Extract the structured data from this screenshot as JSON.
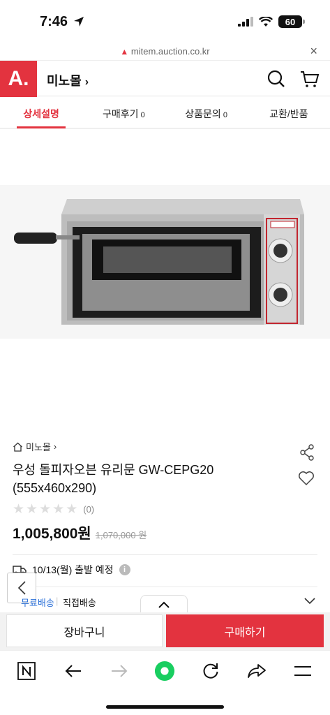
{
  "status": {
    "time": "7:46",
    "battery": "60"
  },
  "browser": {
    "url": "mitem.auction.co.kr"
  },
  "header": {
    "logo": "A.",
    "mall_name": "미노몰"
  },
  "tabs": [
    {
      "label": "상세설명",
      "count": ""
    },
    {
      "label": "구매후기",
      "count": "0"
    },
    {
      "label": "상품문의",
      "count": "0"
    },
    {
      "label": "교환/반품",
      "count": ""
    }
  ],
  "product": {
    "breadcrumb": "미노몰",
    "title": "우성 돌피자오븐 유리문 GW-CEPG20 (555x460x290)",
    "review_count": "(0)",
    "rating": 0,
    "price": "1,005,800원",
    "original_price": "1,070,000 원",
    "shipping": "10/13(월) 출발 예정"
  },
  "delivery": {
    "option_1": "무료배송",
    "option_2": "직접배송"
  },
  "actions": {
    "cart": "장바구니",
    "buy": "구매하기"
  },
  "colors": {
    "brand": "#e3333f"
  }
}
